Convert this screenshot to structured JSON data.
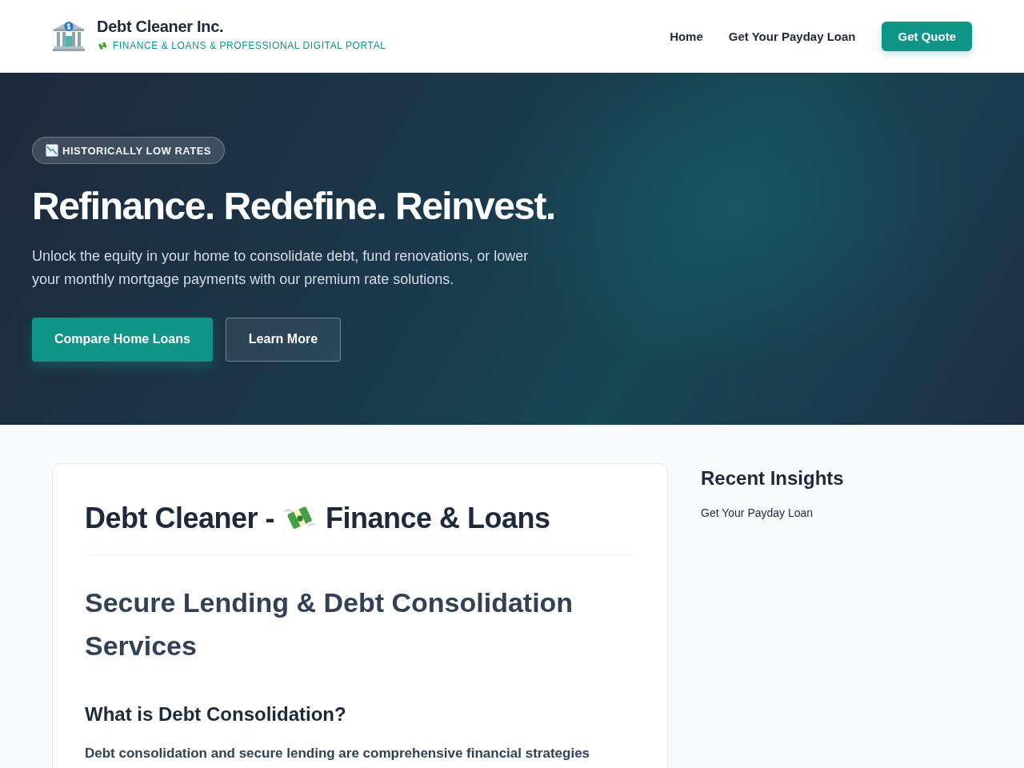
{
  "header": {
    "brand": {
      "name": "Debt Cleaner Inc.",
      "tagline": "FINANCE & LOANS & PROFESSIONAL DIGITAL PORTAL"
    },
    "nav": [
      {
        "label": "Home",
        "kind": "link"
      },
      {
        "label": "Get Your Payday Loan",
        "kind": "link"
      },
      {
        "label": "Get Quote",
        "kind": "button"
      }
    ]
  },
  "hero": {
    "badge": "HISTORICALLY LOW RATES",
    "title": "Refinance. Redefine. Reinvest.",
    "text": "Unlock the equity in your home to consolidate debt, fund renovations, or lower your monthly mortgage payments with our premium rate solutions.",
    "buttons": [
      {
        "label": "Compare Home Loans",
        "kind": "primary"
      },
      {
        "label": "Learn More",
        "kind": "secondary"
      }
    ]
  },
  "article": {
    "title_parts": [
      "Debt Cleaner -",
      "Finance & Loans"
    ],
    "subtitle": "Secure Lending & Debt Consolidation Services",
    "section_heading": "What is Debt Consolidation?",
    "paragraph": "Debt consolidation and secure lending are comprehensive financial strategies"
  },
  "sidebar": {
    "title": "Recent Insights",
    "links": [
      "Get Your Payday Loan"
    ]
  }
}
